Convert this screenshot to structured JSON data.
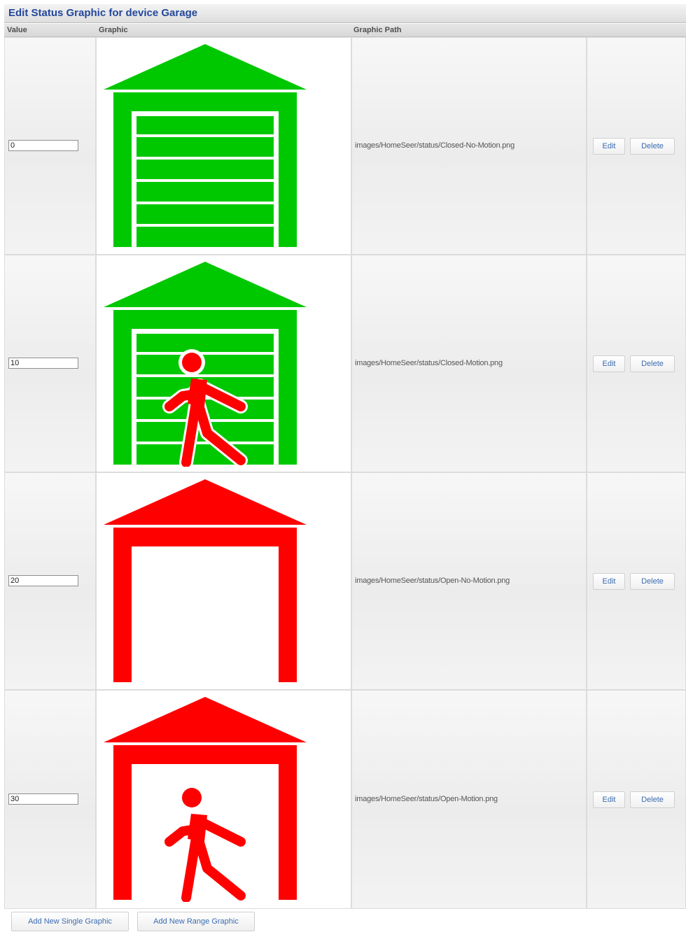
{
  "title": "Edit Status Graphic for device Garage",
  "columns": {
    "value": "Value",
    "graphic": "Graphic",
    "path": "Graphic Path"
  },
  "rows": [
    {
      "value": "0",
      "path": "images/HomeSeer/status/Closed-No-Motion.png",
      "graphic": "garage-closed-no-motion-icon",
      "color": "#00c800",
      "door": "closed",
      "motion": false,
      "edit_label": "Edit",
      "delete_label": "Delete"
    },
    {
      "value": "10",
      "path": "images/HomeSeer/status/Closed-Motion.png",
      "graphic": "garage-closed-motion-icon",
      "color": "#00c800",
      "door": "closed",
      "motion": true,
      "edit_label": "Edit",
      "delete_label": "Delete"
    },
    {
      "value": "20",
      "path": "images/HomeSeer/status/Open-No-Motion.png",
      "graphic": "garage-open-no-motion-icon",
      "color": "#ff0000",
      "door": "open",
      "motion": false,
      "edit_label": "Edit",
      "delete_label": "Delete"
    },
    {
      "value": "30",
      "path": "images/HomeSeer/status/Open-Motion.png",
      "graphic": "garage-open-motion-icon",
      "color": "#ff0000",
      "door": "open",
      "motion": true,
      "edit_label": "Edit",
      "delete_label": "Delete"
    }
  ],
  "footer": {
    "add_single_label": "Add New Single Graphic",
    "add_range_label": "Add New Range Graphic"
  },
  "colors": {
    "title": "#23479b",
    "button_text": "#3a6bb0",
    "closed": "#00c800",
    "open": "#ff0000",
    "person": "#ff0000"
  }
}
